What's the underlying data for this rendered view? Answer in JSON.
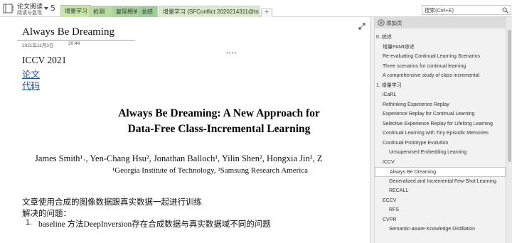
{
  "notebook": {
    "name": "论文阅读",
    "section": "阅读与复现",
    "sync_glyph": "5"
  },
  "tabs": [
    {
      "label": "增量学习",
      "color": "#c7e7a9",
      "active": true
    },
    {
      "label": "检测",
      "color": "#b7dca2",
      "active": false
    },
    {
      "label": "复现相关",
      "color": "#a7d49b",
      "active": false
    },
    {
      "label": "总结",
      "color": "#9cd097",
      "active": false
    },
    {
      "label": "增量学习 (SFConflict 2020214311@tsin...",
      "color": "#d8eccb",
      "active": false
    }
  ],
  "tab_add_glyph": "+",
  "search": {
    "placeholder": "搜索(Ctrl+E)"
  },
  "page": {
    "title": "Always Be Dreaming",
    "date": "2021年11月3日",
    "time": "20:44",
    "venue": "ICCV 2021",
    "link_paper": "论文",
    "link_code": "代码",
    "paper_title_line1": "Always Be Dreaming: A New Approach for",
    "paper_title_line2": "Data-Free Class-Incremental Learning",
    "authors": "James Smith¹˒, Yen-Chang Hsu², Jonathan Balloch¹, Yilin Shen², Hongxia Jin², Z",
    "affiliations": "¹Georgia Institute of Technology, ²Samsung Research America",
    "note1": "文章使用合成的图像数据跟真实数据一起进行训练",
    "note2": "解决的问题：",
    "list_number": "1.",
    "list_item1": "baseline 方法DeepInversion存在合成数据与真实数据域不同的问题"
  },
  "pane": {
    "add_page_label": "添加页",
    "pages": [
      {
        "label": "0. 综述",
        "level": 0
      },
      {
        "label": "增量PAMI综述",
        "level": 1
      },
      {
        "label": "Re-evaluating Continual Learning Scenarios",
        "level": 1
      },
      {
        "label": "Three scenarios for continual learning",
        "level": 1
      },
      {
        "label": "A comprehensive study of class incremental",
        "level": 1
      },
      {
        "label": "1. 增量学习",
        "level": 0
      },
      {
        "label": "iCaRL",
        "level": 1
      },
      {
        "label": "Rethinking Experience Replay",
        "level": 1
      },
      {
        "label": "Experience Replay for Continual Learning",
        "level": 1
      },
      {
        "label": "Selective Experience Replay for Lifelong Learning",
        "level": 1
      },
      {
        "label": "Continual Learning with Tiny Episodic Memories",
        "level": 1
      },
      {
        "label": "Continual Prototype Evolution",
        "level": 1
      },
      {
        "label": "Unsupervised Embedding Learning",
        "level": 2
      },
      {
        "label": "ICCV",
        "level": 1
      },
      {
        "label": "Always Be Dreaming",
        "level": 2,
        "selected": true
      },
      {
        "label": "Generalized and Incremental Few-Shot Learning",
        "level": 2
      },
      {
        "label": "RECALL",
        "level": 2
      },
      {
        "label": "ECCV",
        "level": 1
      },
      {
        "label": "RFS",
        "level": 2
      },
      {
        "label": "CVPR",
        "level": 1
      },
      {
        "label": "Semantic-aware Knowledge Distillation",
        "level": 2
      }
    ]
  },
  "colors": {
    "link": "#1f4fb3",
    "pane_bg": "#f2f2f2",
    "add_page_bg": "#dcdcdc"
  },
  "icons": [
    "notebook-icon",
    "chevron-down-icon",
    "sync-icon",
    "search-icon",
    "expand-icon",
    "add-page-icon"
  ]
}
